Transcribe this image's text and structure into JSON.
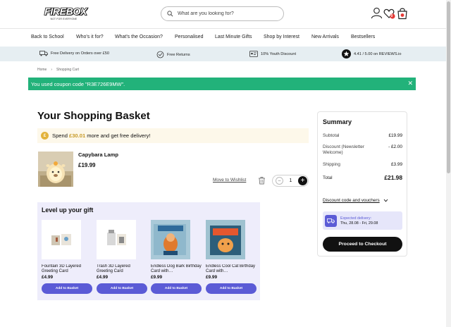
{
  "header": {
    "logo_text": "FIREBOX",
    "logo_tagline": "NOT FOR EVERYONE",
    "search_placeholder": "What are you looking for?",
    "wishlist_count": "0"
  },
  "nav": {
    "items": [
      "Back to School",
      "Who's it for?",
      "What's the Occasion?",
      "Personalised",
      "Last Minute Gifts",
      "Shop by Interest",
      "New Arrivals",
      "Bestsellers"
    ]
  },
  "benefits": [
    "Free Delivery on Orders over £50",
    "Free Returns",
    "10% Youth Discount",
    "4.41 / 5.00 on REVIEWS.io"
  ],
  "breadcrumb": {
    "home": "Home",
    "current": "Shopping Cart"
  },
  "coupon_message": "You used coupon code \"R3E726E9MW\".",
  "page_title": "Your Shopping Basket",
  "free_delivery": {
    "prefix": "Spend",
    "amount": "£30.01",
    "suffix": "more and get free delivery!"
  },
  "basket_item": {
    "name": "Capybara Lamp",
    "price": "£19.99",
    "wishlist_link": "Move to Wishlist",
    "quantity": "1"
  },
  "level_up": {
    "title": "Level up your gift",
    "products": [
      {
        "name": "Fountain 3D Layered Greeting Card",
        "price": "£4.99",
        "button": "Add to Basket"
      },
      {
        "name": "Trash 3D Layered Greeting Card",
        "price": "£4.99",
        "button": "Add to Basket"
      },
      {
        "name": "Endless Dog Bark Birthday Card with…",
        "price": "£9.99",
        "button": "Add to Basket"
      },
      {
        "name": "Endless Cool Cat Birthday Card with…",
        "price": "£9.99",
        "button": "Add to Basket"
      }
    ]
  },
  "summary": {
    "title": "Summary",
    "subtotal_label": "Subtotal",
    "subtotal": "£19.99",
    "discount_label": "Discount (Newsletter Welcome)",
    "discount": "- £2.00",
    "shipping_label": "Shipping",
    "shipping": "£3.99",
    "total_label": "Total",
    "total": "£21.98",
    "discount_link": "Discount code and vouchers",
    "expected_label": "Expected delivery:",
    "expected_dates": "Thu, 28.08 - Fri, 29.08",
    "checkout": "Proceed to Checkout"
  },
  "colors": {
    "accent": "#5b5bd6",
    "success": "#22b27a",
    "promo_bg": "#fdf8ea",
    "benefit_bg": "#e6eef2"
  }
}
